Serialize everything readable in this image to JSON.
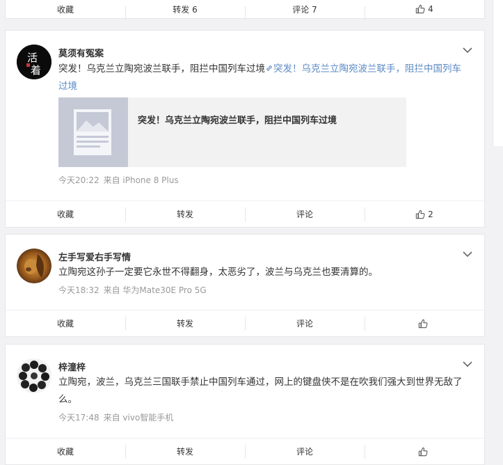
{
  "posts": [
    {
      "actions": {
        "collect": "收藏",
        "repost": "转发 6",
        "comment": "评论 7",
        "like": "4"
      }
    },
    {
      "author": "莫须有冤案",
      "avatar_text": "活着",
      "text": "突发！乌克兰立陶宛波兰联手，阻拦中国列车过境",
      "link_text": "突发！乌克兰立陶宛波兰联手，阻拦中国列车过境",
      "share_card_title": "突发！乌克兰立陶宛波兰联手，阻拦中国列车过境",
      "time": "今天20:22",
      "source": "来自 iPhone 8 Plus",
      "actions": {
        "collect": "收藏",
        "repost": "转发",
        "comment": "评论",
        "like": "2"
      }
    },
    {
      "author": "左手写爱右手写情",
      "text": "立陶宛这孙子一定要它永世不得翻身，太恶劣了，波兰与乌克兰也要清算的。",
      "time": "今天18:32",
      "source": "来自 华为Mate30E Pro 5G",
      "actions": {
        "collect": "收藏",
        "repost": "转发",
        "comment": "评论",
        "like": ""
      }
    },
    {
      "author": "梓潼梓",
      "text": "立陶宛，波兰，乌克兰三国联手禁止中国列车通过，网上的键盘侠不是在吹我们强大到世界无敌了么。",
      "time": "今天17:48",
      "source": "来自 vivo智能手机",
      "actions": {
        "collect": "收藏",
        "repost": "转发",
        "comment": "评论",
        "like": ""
      }
    }
  ],
  "icons": {
    "like": "thumbs-up-icon",
    "chevron": "chevron-down-icon",
    "link": "link-icon"
  },
  "colors": {
    "link": "#5b8ac4",
    "meta": "#999999",
    "background": "#f2f2f5"
  }
}
